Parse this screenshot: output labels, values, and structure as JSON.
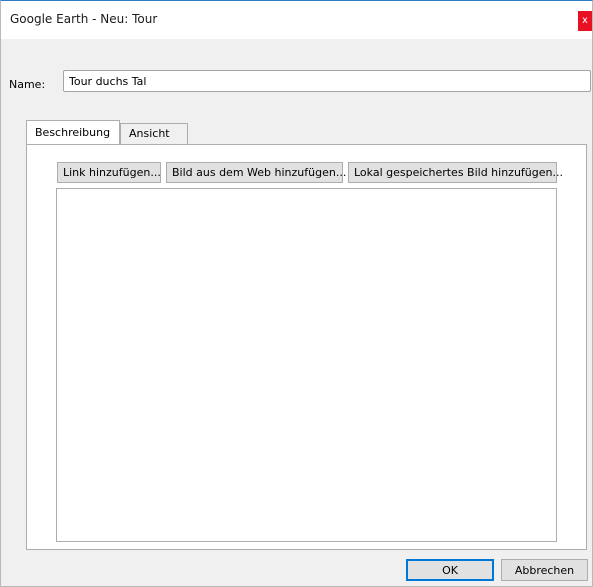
{
  "window": {
    "title": "Google Earth - Neu: Tour",
    "close_glyph": "x",
    "close_color": "#e81123",
    "accent": "#0078d7"
  },
  "form": {
    "name_label": "Name:",
    "name_value": "Tour duchs Tal"
  },
  "tabs": [
    {
      "label": "Beschreibung",
      "active": true
    },
    {
      "label": "Ansicht",
      "active": false
    }
  ],
  "toolbar": {
    "add_link": "Link hinzufügen...",
    "add_web_image": "Bild aus dem Web hinzufügen...",
    "add_local_image": "Lokal gespeichertes Bild hinzufügen..."
  },
  "editor": {
    "content": ""
  },
  "buttons": {
    "ok": "OK",
    "cancel": "Abbrechen"
  }
}
